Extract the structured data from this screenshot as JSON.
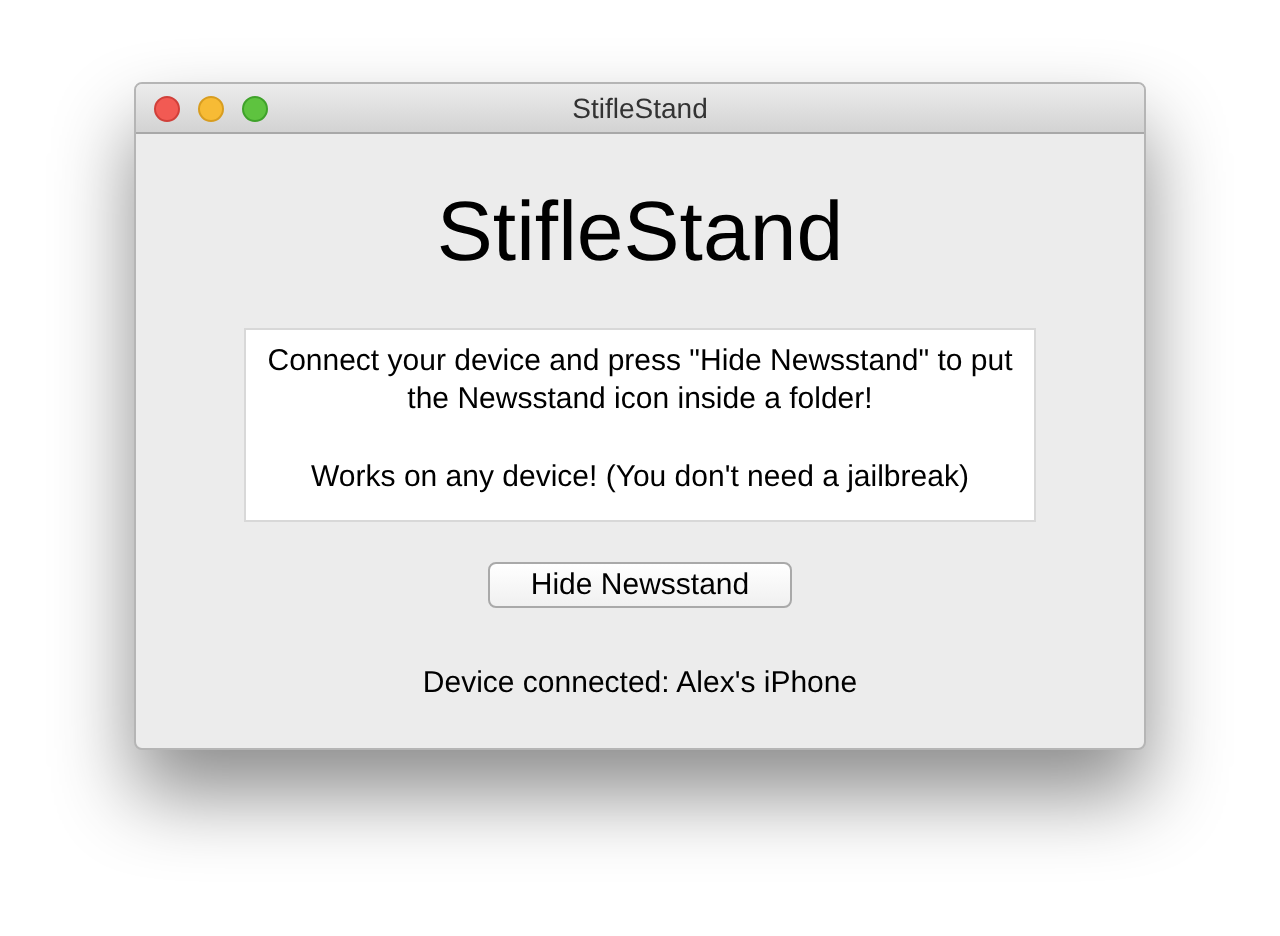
{
  "window": {
    "title": "StifleStand"
  },
  "heading": "StifleStand",
  "info": {
    "paragraphs": [
      "Connect your device and press \"Hide Newsstand\" to put the Newsstand icon inside a folder!",
      "Works on any device! (You don't need a jailbreak)"
    ]
  },
  "button": {
    "label": "Hide Newsstand"
  },
  "status": "Device connected: Alex's iPhone"
}
